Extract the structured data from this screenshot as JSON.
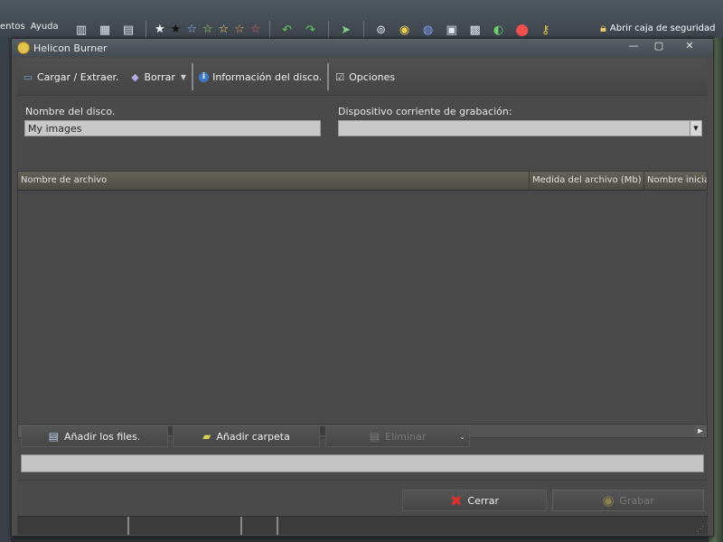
{
  "host": {
    "menu": [
      "entos",
      "Ayuda"
    ],
    "toolbar_stars": 7,
    "safe_label": "Abrir caja de seguridad"
  },
  "dialog": {
    "title": "Helicon Burner",
    "ribbon": {
      "load_label": "Cargar / Extraer.",
      "erase_label": "Borrar",
      "info_label": "Información del disco.",
      "options_label": "Opciones"
    },
    "disc_name_label": "Nombre del disco.",
    "disc_name_value": "My images",
    "device_label": "Dispositivo corriente de grabación:",
    "device_value": "",
    "table": {
      "columns": [
        "Nombre de archivo",
        "Medida del archivo (Mb)",
        "Nombre inicial del"
      ],
      "rows": []
    },
    "buttons": {
      "add_files": "Añadir los files.",
      "add_folder": "Añadir carpeta",
      "delete": "Eliminar",
      "close": "Cerrar",
      "burn": "Grabar"
    },
    "progress_percent": 0
  },
  "colors": {
    "dialog_bg": "#4c4c4c",
    "field_bg": "#c8c8c8",
    "accent_info": "#3b79d0",
    "close_icon": "#e0302a",
    "burn_icon": "#c9b24a"
  }
}
